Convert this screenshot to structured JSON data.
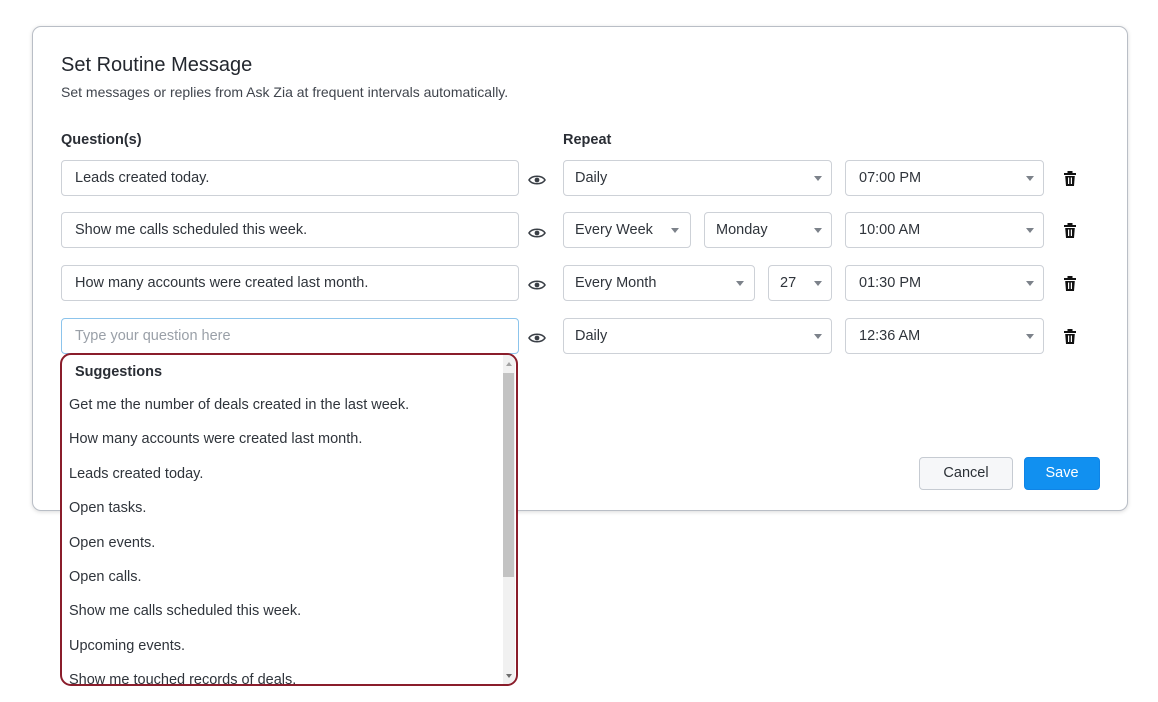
{
  "dialog": {
    "title": "Set Routine Message",
    "subtitle": "Set messages or replies from Ask Zia at frequent intervals automatically.",
    "questions_label": "Question(s)",
    "repeat_label": "Repeat"
  },
  "rows": [
    {
      "question": "Leads created today.",
      "repeat": "Daily",
      "time": "07:00 PM"
    },
    {
      "question": "Show me calls scheduled this week.",
      "repeat": "Every Week",
      "day": "Monday",
      "time": "10:00 AM"
    },
    {
      "question": "How many accounts were created last month.",
      "repeat": "Every Month",
      "date": "27",
      "time": "01:30 PM"
    },
    {
      "question": "",
      "placeholder": "Type your question here",
      "repeat": "Daily",
      "time": "12:36 AM"
    }
  ],
  "suggestions": {
    "heading": "Suggestions",
    "items": [
      "Get me the number of deals created in the last week.",
      "How many accounts were created last month.",
      "Leads created today.",
      "Open tasks.",
      "Open events.",
      "Open calls.",
      "Show me calls scheduled this week.",
      "Upcoming events.",
      "Show me touched records of deals."
    ]
  },
  "buttons": {
    "cancel": "Cancel",
    "save": "Save"
  },
  "icons": {
    "preview": "eye-icon",
    "delete": "trash-icon",
    "dropdown": "caret-down-icon"
  },
  "colors": {
    "accent": "#1190f0",
    "suggestion_border": "#8a1d2b",
    "active_input_border": "#8cc4ec"
  }
}
